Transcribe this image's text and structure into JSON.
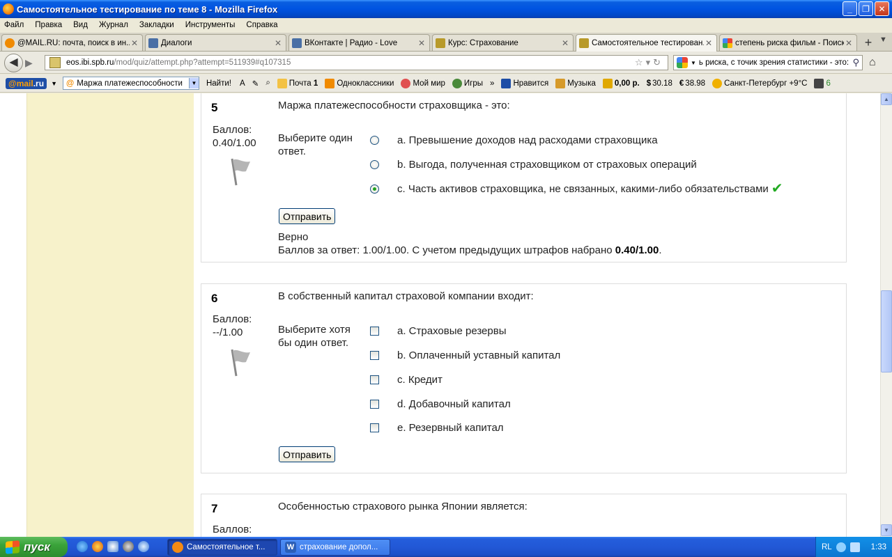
{
  "window": {
    "title": "Самостоятельное тестирование по теме 8 - Mozilla Firefox",
    "buttons": [
      "_",
      "❐",
      "✕"
    ]
  },
  "menu": [
    "Файл",
    "Правка",
    "Вид",
    "Журнал",
    "Закладки",
    "Инструменты",
    "Справка"
  ],
  "tabs": [
    {
      "label": "@MAIL.RU: почта, поиск в ин...",
      "icon_color": "#f08a00"
    },
    {
      "label": "Диалоги",
      "icon_color": "#4a6fa5"
    },
    {
      "label": "ВКонтакте | Радио - Love",
      "icon_color": "#4a6fa5"
    },
    {
      "label": "Курс: Страхование",
      "icon_color": "#b89a2a"
    },
    {
      "label": "Самостоятельное тестирован...",
      "icon_color": "#b89a2a"
    },
    {
      "label": "степень риска фильм - Поиск ...",
      "icon_color": "#34a853"
    }
  ],
  "nav": {
    "url_host": "eos.ibi.spb.ru",
    "url_path": "/mod/quiz/attempt.php?attempt=511939#q107315",
    "search_value": "ь риска, с точик зрения статистики - это:"
  },
  "mailbar": {
    "logo_text": "@mail",
    "logo_suffix": ".ru",
    "search_value": "Маржа платежеспособности",
    "find_label": "Найти!",
    "items": [
      {
        "label": "Почта",
        "badge": "1",
        "icon_color": "#f3c245"
      },
      {
        "label": "Одноклассники",
        "icon_color": "#f08a00"
      },
      {
        "label": "Мой мир",
        "icon_color": "#e05050"
      },
      {
        "label": "Игры",
        "icon_color": "#4a8a3a"
      },
      {
        "label": "»",
        "icon_color": ""
      },
      {
        "label": "Нравится",
        "icon_color": "#1e4ea6"
      },
      {
        "label": "Музыка",
        "icon_color": "#d69a2a"
      },
      {
        "label": "0,00 р.",
        "icon_color": "#e0a800"
      },
      {
        "label": "30.18",
        "icon_color": "#2a7a2a"
      },
      {
        "label": "38.98",
        "icon_color": "#2a5aa0"
      },
      {
        "label": "Санкт-Петербург +9°С",
        "icon_color": "#f0b000"
      },
      {
        "label": "6",
        "icon_color": "#444444"
      }
    ]
  },
  "questions": [
    {
      "number": "5",
      "grade_label": "Баллов:",
      "grade_value": "0.40/1.00",
      "text": "Маржа платежеспособности страховщика - это:",
      "prompt": "Выберите один ответ.",
      "type": "radio",
      "options": [
        {
          "label": "a. Превышение доходов над расходами страховщика",
          "checked": false
        },
        {
          "label": "b. Выгода, полученная страховщиком от страховых операций",
          "checked": false
        },
        {
          "label": "c. Часть активов страховщика, не связанных, какими-либо обязательствами",
          "checked": true,
          "correct": true
        }
      ],
      "submit_label": "Отправить",
      "feedback_status": "Верно",
      "feedback_prefix": "Баллов за ответ: 1.00/1.00. С учетом предыдущих штрафов набрано ",
      "feedback_score": "0.40/1.00",
      "feedback_suffix": "."
    },
    {
      "number": "6",
      "grade_label": "Баллов:",
      "grade_value": "--/1.00",
      "text": "В собственный капитал страховой компании входит:",
      "prompt": "Выберите хотя бы один ответ.",
      "type": "checkbox",
      "options": [
        {
          "label": "a. Страховые резервы",
          "checked": false
        },
        {
          "label": "b. Оплаченный уставный капитал",
          "checked": false
        },
        {
          "label": "c. Кредит",
          "checked": false
        },
        {
          "label": "d. Добавочный капитал",
          "checked": false
        },
        {
          "label": "e. Резервный капитал",
          "checked": false
        }
      ],
      "submit_label": "Отправить"
    },
    {
      "number": "7",
      "grade_label": "Баллов:",
      "text": "Особенностью страхового рынка Японии является:"
    }
  ],
  "taskbar": {
    "start_label": "пуск",
    "tasks": [
      {
        "label": "Самостоятельное т...",
        "active": true,
        "icon_color": "#f48a14"
      },
      {
        "label": "страхование допол...",
        "active": false,
        "icon_color": "#2b5fb8"
      }
    ],
    "lang": "RL",
    "clock": "1:33"
  },
  "colors": {
    "left_column": "#f7f2cb",
    "correct": "#22aa22",
    "titlebar": "#0053e1"
  }
}
